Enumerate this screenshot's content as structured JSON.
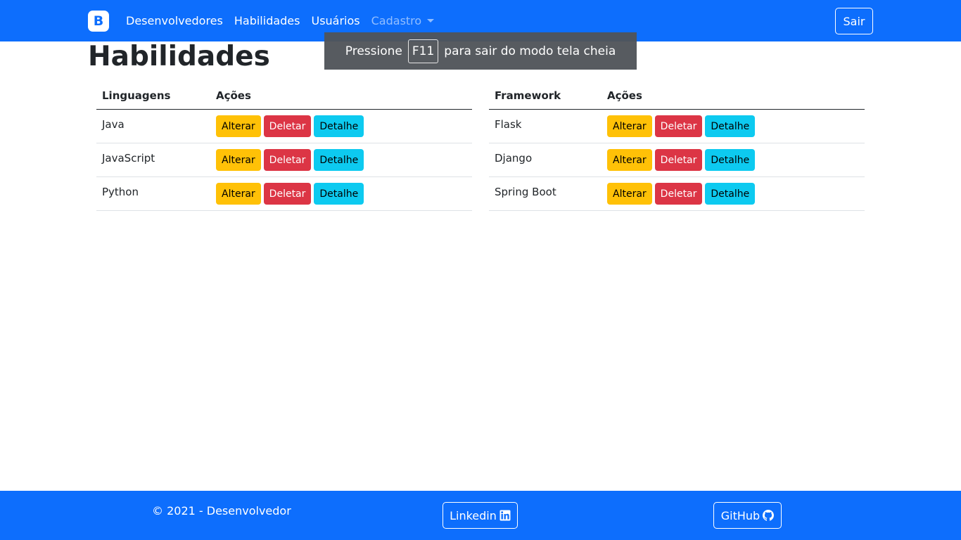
{
  "colors": {
    "primary": "#0d6efd",
    "warning": "#ffc107",
    "danger": "#dc3545",
    "info": "#0dcaf0"
  },
  "navbar": {
    "brand": "B",
    "links": [
      {
        "label": "Desenvolvedores"
      },
      {
        "label": "Habilidades"
      },
      {
        "label": "Usuários"
      },
      {
        "label": "Cadastro"
      }
    ],
    "logout_label": "Sair"
  },
  "fullscreen_toast": {
    "prefix": "Pressione",
    "key": "F11",
    "suffix": "para sair do modo tela cheia"
  },
  "page": {
    "title": "Habilidades"
  },
  "tables": [
    {
      "headers": [
        "Linguagens",
        "Ações"
      ],
      "rows": [
        {
          "name": "Java"
        },
        {
          "name": "JavaScript"
        },
        {
          "name": "Python"
        }
      ]
    },
    {
      "headers": [
        "Framework",
        "Ações"
      ],
      "rows": [
        {
          "name": "Flask"
        },
        {
          "name": "Django"
        },
        {
          "name": "Spring Boot"
        }
      ]
    }
  ],
  "actions": {
    "edit": "Alterar",
    "delete": "Deletar",
    "detail": "Detalhe"
  },
  "footer": {
    "copyright": "© 2021 - Desenvolvedor",
    "linkedin_label": "Linkedin",
    "github_label": "GitHub",
    "linkedin_icon": "linkedin-icon",
    "github_icon": "github-icon"
  }
}
